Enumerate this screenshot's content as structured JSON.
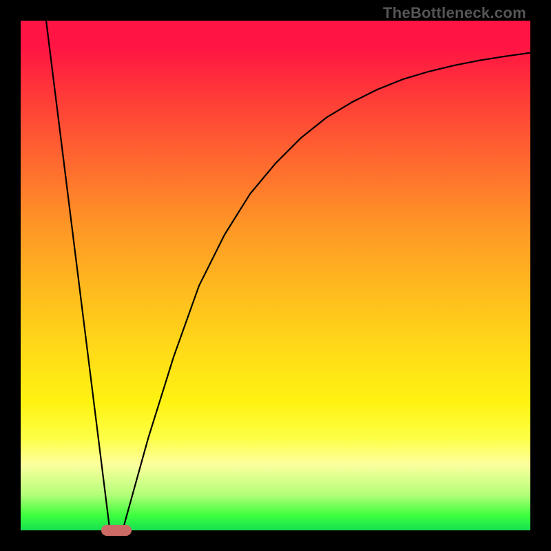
{
  "watermark": "TheBottleneck.com",
  "chart_data": {
    "type": "line",
    "title": "",
    "xlabel": "",
    "ylabel": "",
    "x_range": [
      0,
      100
    ],
    "y_range": [
      0,
      100
    ],
    "series": [
      {
        "name": "descending-segment",
        "x": [
          5,
          17.5
        ],
        "y": [
          100,
          0
        ]
      },
      {
        "name": "ascending-curve",
        "x": [
          20,
          25,
          30,
          35,
          40,
          45,
          50,
          55,
          60,
          65,
          70,
          75,
          80,
          85,
          90,
          95,
          100
        ],
        "y": [
          0,
          18,
          34,
          48,
          58,
          66,
          72,
          77,
          81,
          84,
          86.5,
          88.5,
          90,
          91.2,
          92.2,
          93,
          93.7
        ]
      }
    ],
    "marker": {
      "x": 18.8,
      "y": 0,
      "color": "#cc6b66"
    },
    "background_gradient": {
      "orientation": "vertical",
      "stops": [
        {
          "pos": 0.0,
          "color": "#ff1443"
        },
        {
          "pos": 0.05,
          "color": "#ff1443"
        },
        {
          "pos": 0.15,
          "color": "#ff3b38"
        },
        {
          "pos": 0.28,
          "color": "#ff6a2f"
        },
        {
          "pos": 0.4,
          "color": "#ff9526"
        },
        {
          "pos": 0.52,
          "color": "#ffb81f"
        },
        {
          "pos": 0.64,
          "color": "#ffd918"
        },
        {
          "pos": 0.75,
          "color": "#fff312"
        },
        {
          "pos": 0.82,
          "color": "#fdff47"
        },
        {
          "pos": 0.87,
          "color": "#fdff9e"
        },
        {
          "pos": 0.93,
          "color": "#b4ff7a"
        },
        {
          "pos": 0.97,
          "color": "#3eff3e"
        },
        {
          "pos": 1.0,
          "color": "#15e050"
        }
      ]
    },
    "frame": {
      "border_color": "#000000",
      "border_width_px": 30
    }
  }
}
